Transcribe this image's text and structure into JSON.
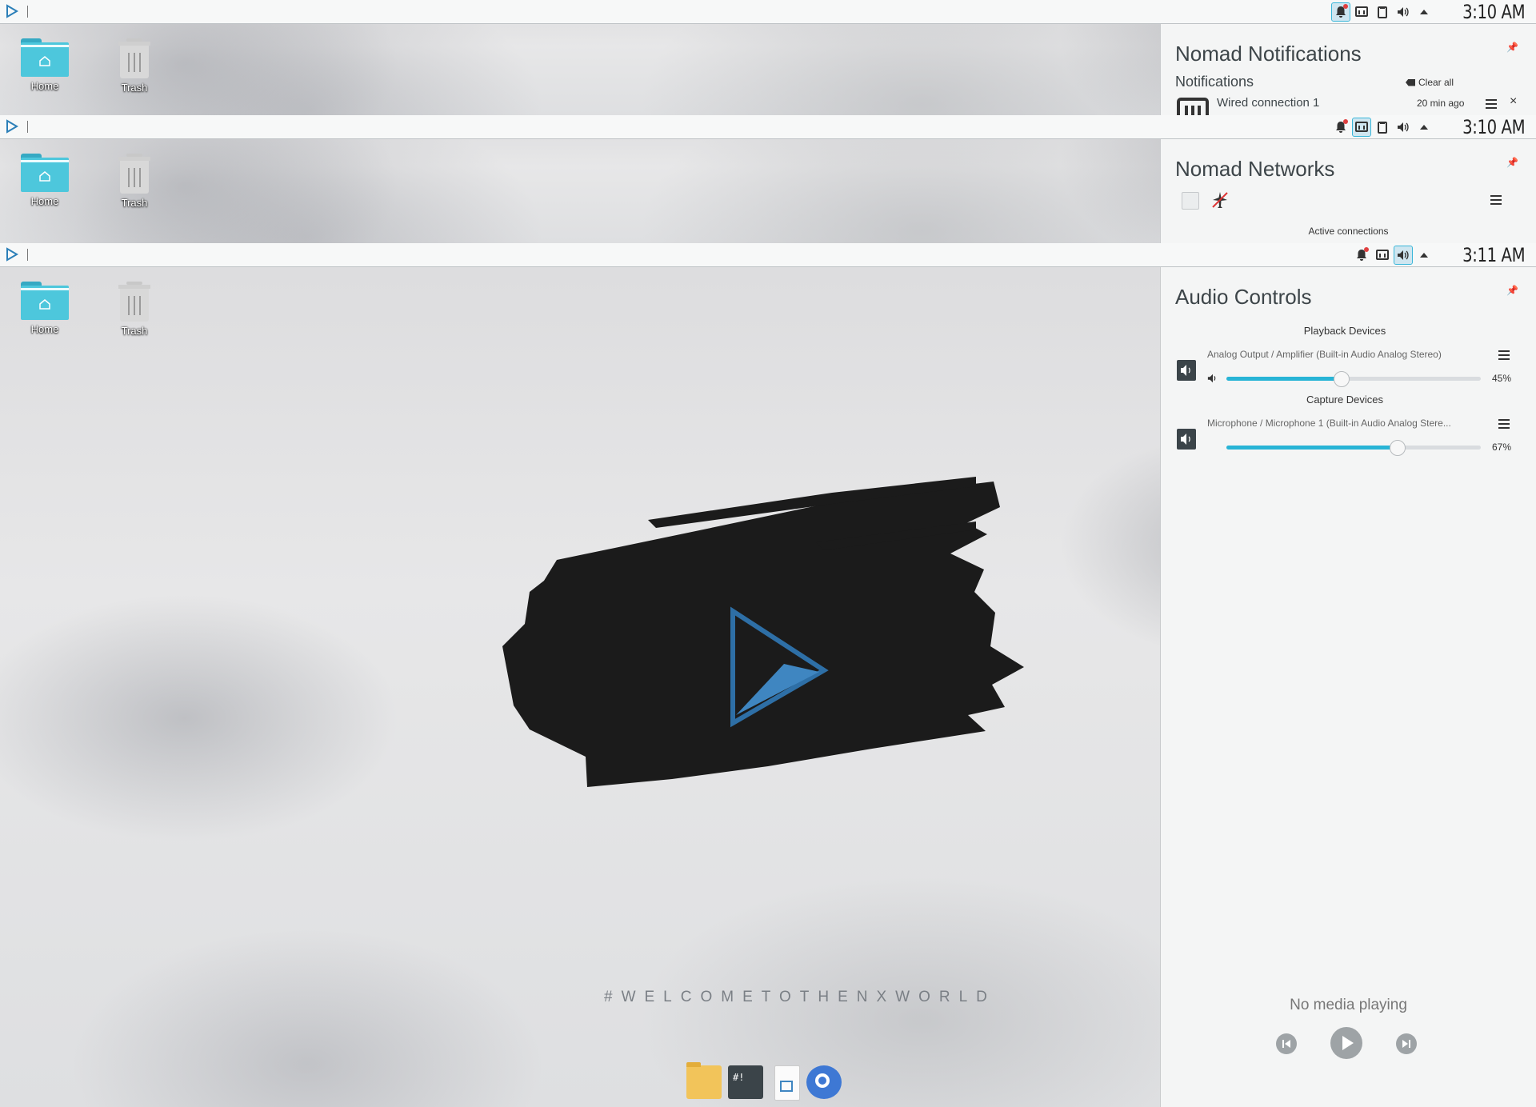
{
  "desktop": {
    "icons": [
      {
        "label": "Home",
        "icon": "home-folder-icon"
      },
      {
        "label": "Trash",
        "icon": "trash-icon"
      }
    ],
    "hashtag": "#WELCOMETOTHENXWORLD"
  },
  "screens": [
    {
      "clock": "3:10 AM",
      "active_tray": "notifications"
    },
    {
      "clock": "3:10 AM",
      "active_tray": "network"
    },
    {
      "clock": "3:11 AM",
      "active_tray": "audio"
    }
  ],
  "notifications": {
    "title": "Nomad Notifications",
    "section": "Notifications",
    "clear_all": "Clear all",
    "items": [
      {
        "title": "Wired connection 1",
        "time": "20 min ago"
      }
    ]
  },
  "networks": {
    "title": "Nomad Networks",
    "active_label": "Active connections"
  },
  "audio": {
    "title": "Audio Controls",
    "playback_header": "Playback Devices",
    "playback": {
      "name": "Analog Output / Amplifier (Built-in Audio Analog Stereo)",
      "volume": 45,
      "volume_label": "45%"
    },
    "capture_header": "Capture Devices",
    "capture": {
      "name": "Microphone / Microphone 1 (Built-in Audio Analog Stere...",
      "volume": 67,
      "volume_label": "67%"
    },
    "media_status": "No media playing"
  },
  "colors": {
    "accent": "#28b4d6",
    "topbar": "#f7f8f8",
    "panel": "#f4f5f5",
    "folder": "#4dc7dc"
  }
}
